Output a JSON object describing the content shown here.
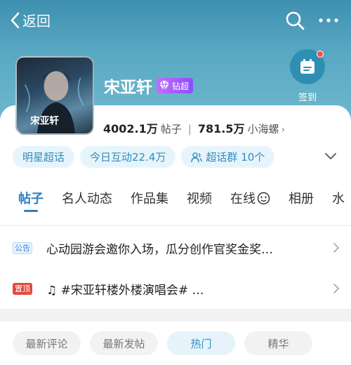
{
  "topbar": {
    "back_label": "返回"
  },
  "profile": {
    "name": "宋亚轩",
    "badge": "钻超",
    "poster_text": "宋亚轩",
    "checkin_label": "签到"
  },
  "stats": {
    "posts_value": "4002.1万",
    "posts_label": "帖子",
    "fans_value": "781.5万",
    "fans_label": "小海螺"
  },
  "chips": [
    {
      "label": "明星超话"
    },
    {
      "label": "今日互动22.4万"
    },
    {
      "label": "超话群 10个"
    }
  ],
  "tabs": [
    {
      "label": "帖子"
    },
    {
      "label": "名人动态"
    },
    {
      "label": "作品集"
    },
    {
      "label": "视频"
    },
    {
      "label": "在线"
    },
    {
      "label": "相册"
    },
    {
      "label": "水"
    }
  ],
  "announcements": [
    {
      "tag": "公告",
      "text": "心动园游会邀你入场，瓜分创作官奖金奖…"
    },
    {
      "tag": "置顶",
      "text": "♫ #宋亚轩楼外楼演唱会# …"
    }
  ],
  "filters": [
    {
      "label": "最新评论"
    },
    {
      "label": "最新发帖"
    },
    {
      "label": "热门"
    },
    {
      "label": "精华"
    }
  ],
  "colors": {
    "accent": "#2c7fc2",
    "header": "#4f9fbf",
    "pin_red": "#e24b3e"
  }
}
